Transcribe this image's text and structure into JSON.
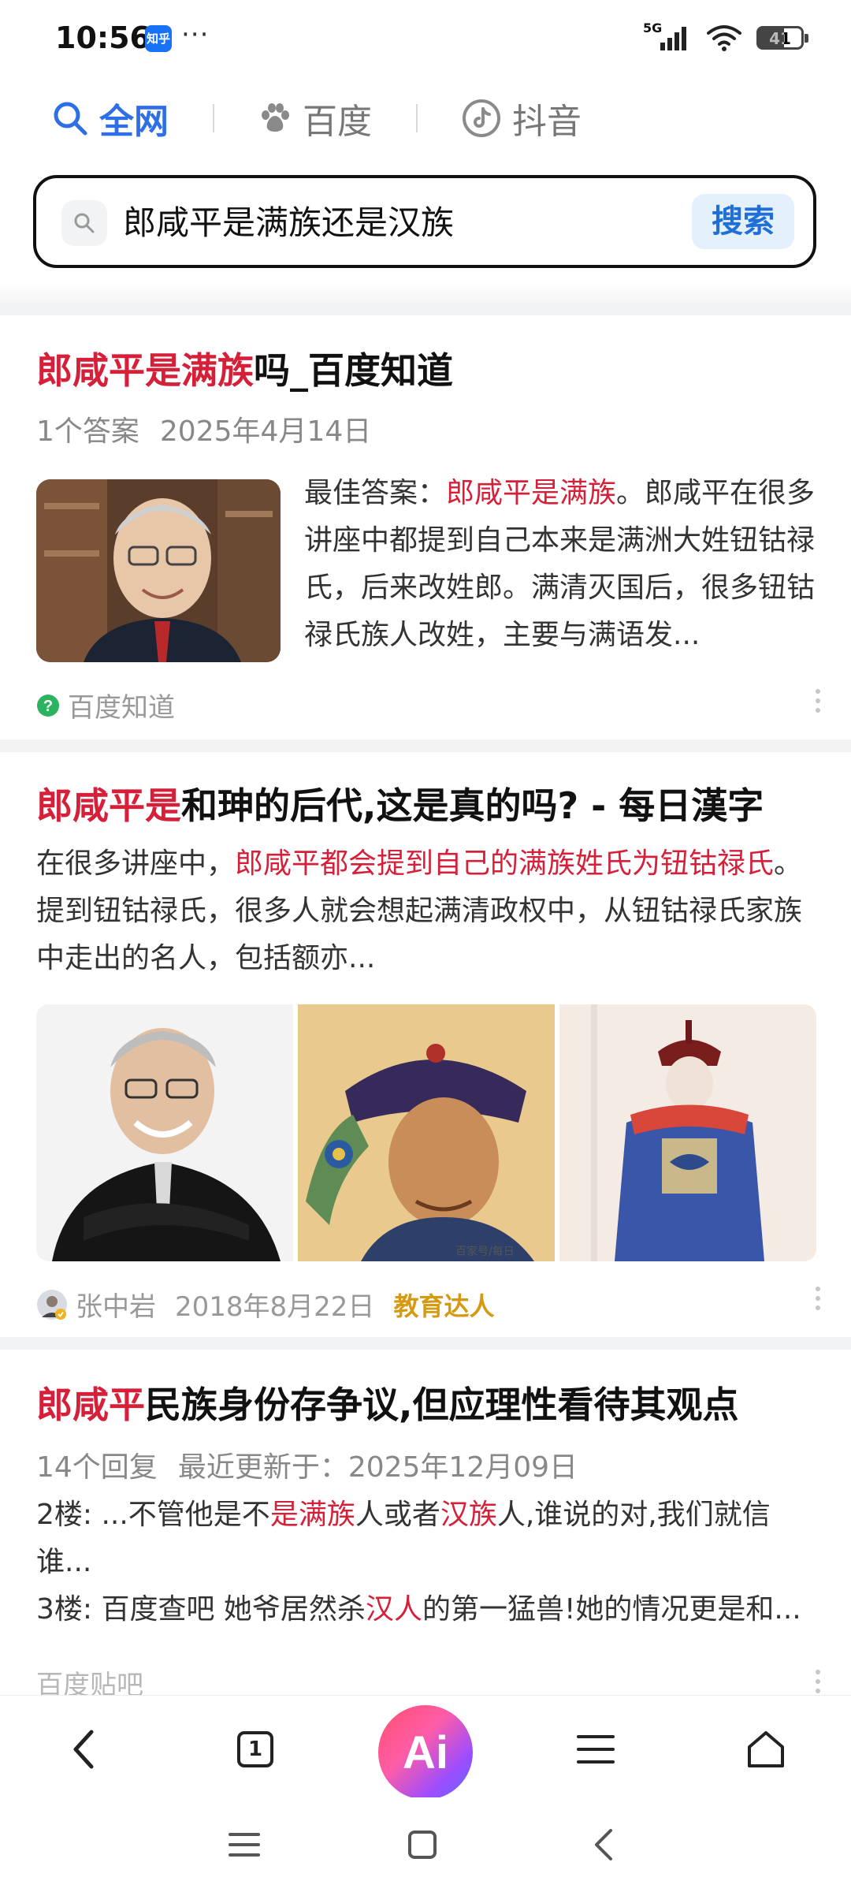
{
  "status_bar": {
    "time": "10:56",
    "app_badge": "知乎",
    "dots": "···",
    "network": "5G",
    "battery": "41"
  },
  "engines": [
    {
      "label": "全网",
      "icon": "search-icon"
    },
    {
      "label": "百度",
      "icon": "baidu-paw-icon"
    },
    {
      "label": "抖音",
      "icon": "douyin-icon"
    }
  ],
  "search": {
    "query": "郎咸平是满族还是汉族",
    "button": "搜索"
  },
  "results": [
    {
      "title_hl": "郎咸平是满族",
      "title_rest": "吗_百度知道",
      "meta": [
        "1个答案",
        "2025年4月14日"
      ],
      "snippet_prefix": "最佳答案：",
      "snippet_hl": "郎咸平是满族",
      "snippet_rest": "。郎咸平在很多讲座中都提到自己本来是满洲大姓钮钴禄氏，后来改姓郎。满清灭国后，很多钮钴禄氏族人改姓，主要与满语发...",
      "source": "百度知道"
    },
    {
      "title_hl": "郎咸平是",
      "title_rest": "和珅的后代,这是真的吗? - 每日漢字",
      "snippet_prefix": "在很多讲座中，",
      "snippet_hl": "郎咸平都会提到自己的满族姓氏为钮钴禄氏",
      "snippet_rest": "。提到钮钴禄氏，很多人就会想起满清政权中，从钮钴禄氏家族中走出的名人，包括额亦...",
      "image_watermark": "百家号/每日",
      "author": "张中岩",
      "date": "2018年8月22日",
      "tag": "教育达人"
    },
    {
      "title_hl": "郎咸平",
      "title_rest": "民族身份存争议,但应理性看待其观点",
      "meta": [
        "14个回复",
        "最近更新于：2025年12月09日"
      ],
      "floor2_prefix": "2楼: ...不管他是不",
      "floor2_hl1": "是满族",
      "floor2_mid": "人或者",
      "floor2_hl2": "汉族",
      "floor2_rest": "人,谁说的对,我们就信谁...",
      "floor3_prefix": "3楼: 百度查吧 她爷居然杀",
      "floor3_hl": "汉人",
      "floor3_rest": "的第一猛兽!她的情况更是和...",
      "source": "百度贴吧"
    }
  ],
  "bottom_nav": {
    "tab_count": "1",
    "ai_label": "Ai"
  },
  "colors": {
    "accent": "#2e6fe8",
    "highlight": "#d6203a",
    "tag": "#d69a12"
  }
}
